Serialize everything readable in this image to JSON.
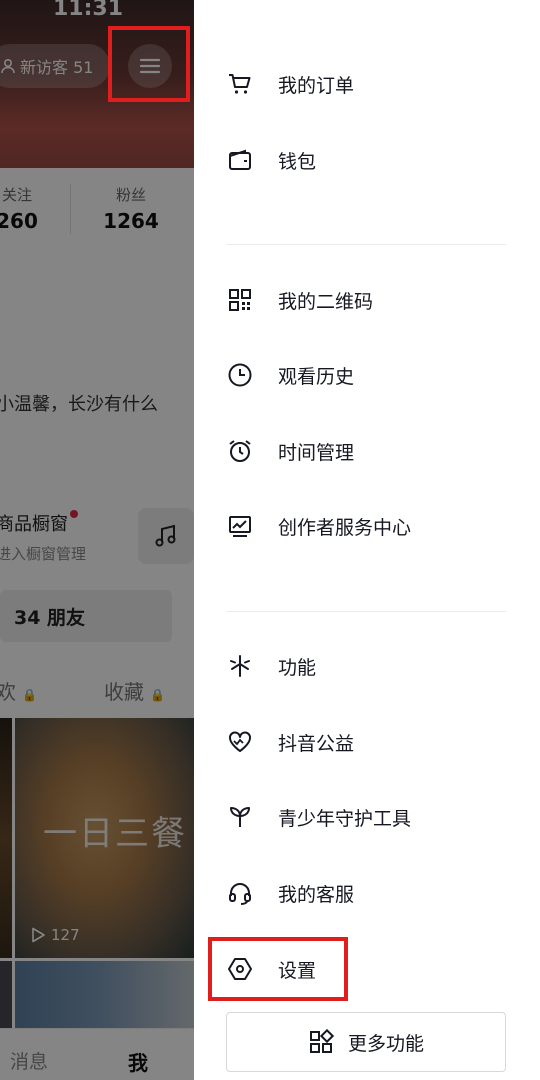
{
  "status_bar": {
    "time": "11:31"
  },
  "profile": {
    "visitor_label": "新访客 51",
    "following_label": "关注",
    "following_value": "260",
    "followers_label": "粉丝",
    "followers_value": "1264",
    "bio": "小温馨，长沙有什么",
    "shop_title": "商品橱窗",
    "shop_subtitle": "进入橱窗管理",
    "friends_button": "34 朋友",
    "tab_works": "欢",
    "tab_collect": "收藏",
    "video_overlay_text": "一日三餐",
    "video_plays": "127",
    "nav_messages": "消息",
    "nav_me": "我"
  },
  "drawer": {
    "items": [
      {
        "label": "我的订单",
        "icon": "cart-icon"
      },
      {
        "label": "钱包",
        "icon": "wallet-icon"
      },
      {
        "label": "我的二维码",
        "icon": "qr-code-icon"
      },
      {
        "label": "观看历史",
        "icon": "clock-icon"
      },
      {
        "label": "时间管理",
        "icon": "alarm-clock-icon"
      },
      {
        "label": "创作者服务中心",
        "icon": "creator-chart-icon"
      },
      {
        "label": "功能",
        "icon": "function-sparkle-icon"
      },
      {
        "label": "抖音公益",
        "icon": "charity-heart-icon"
      },
      {
        "label": "青少年守护工具",
        "icon": "sprout-icon"
      },
      {
        "label": "我的客服",
        "icon": "headset-icon"
      },
      {
        "label": "设置",
        "icon": "settings-hexagon-icon"
      }
    ],
    "more_button": "更多功能"
  },
  "colors": {
    "highlight_box": "#e01e1e",
    "text_primary": "#161823",
    "dim_overlay": "rgba(0,0,0,0.48)"
  }
}
